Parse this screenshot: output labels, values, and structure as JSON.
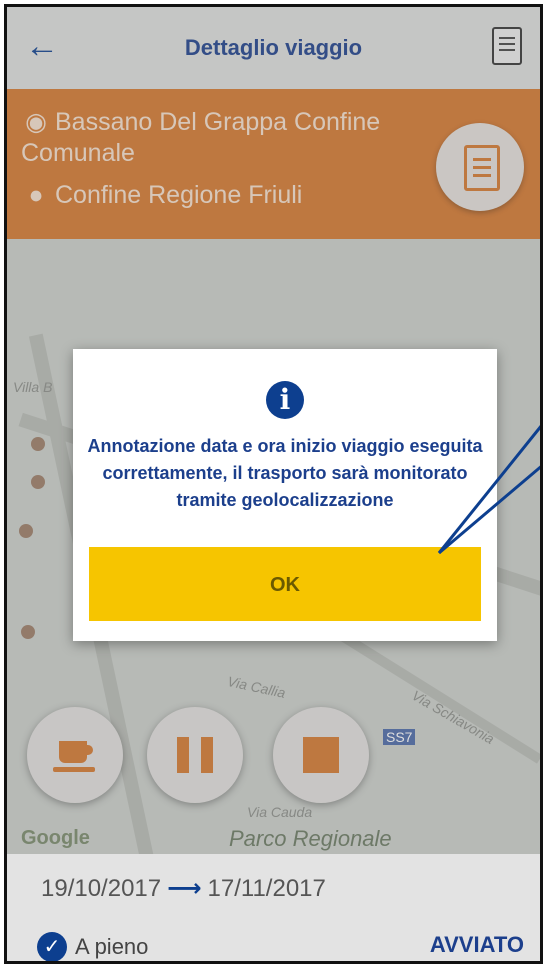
{
  "header": {
    "title": "Dettaglio viaggio",
    "back_icon": "back-arrow-icon",
    "doc_icon": "document-icon"
  },
  "route": {
    "origin": "Bassano Del Grappa Confine",
    "origin_cont": "Comunale",
    "destination": "Confine Regione Friuli",
    "origin_icon": "radio-dot-icon",
    "destination_icon": "map-pin-icon",
    "clipboard_icon": "clipboard-icon"
  },
  "map": {
    "labels": [
      "Villa B",
      "Via Callia",
      "Via Cauda",
      "Via Schiavonia",
      "Parco Regionale",
      "SS7"
    ],
    "google": "Google"
  },
  "controls": [
    "coffee-break-icon",
    "pause-icon",
    "stop-icon"
  ],
  "dialog": {
    "icon": "info-icon",
    "message": "Annotazione data e ora inizio viaggio eseguita correttamente, il trasporto sarà monitorato tramite geolocalizzazione",
    "ok_label": "OK"
  },
  "bottom": {
    "date_start": "19/10/2017",
    "date_end": "17/11/2017",
    "cargo": "A pieno",
    "status": "AVVIATO"
  },
  "colors": {
    "accent_blue": "#1c3f8c",
    "orange": "#d6782e",
    "ok_yellow": "#f6c500"
  }
}
